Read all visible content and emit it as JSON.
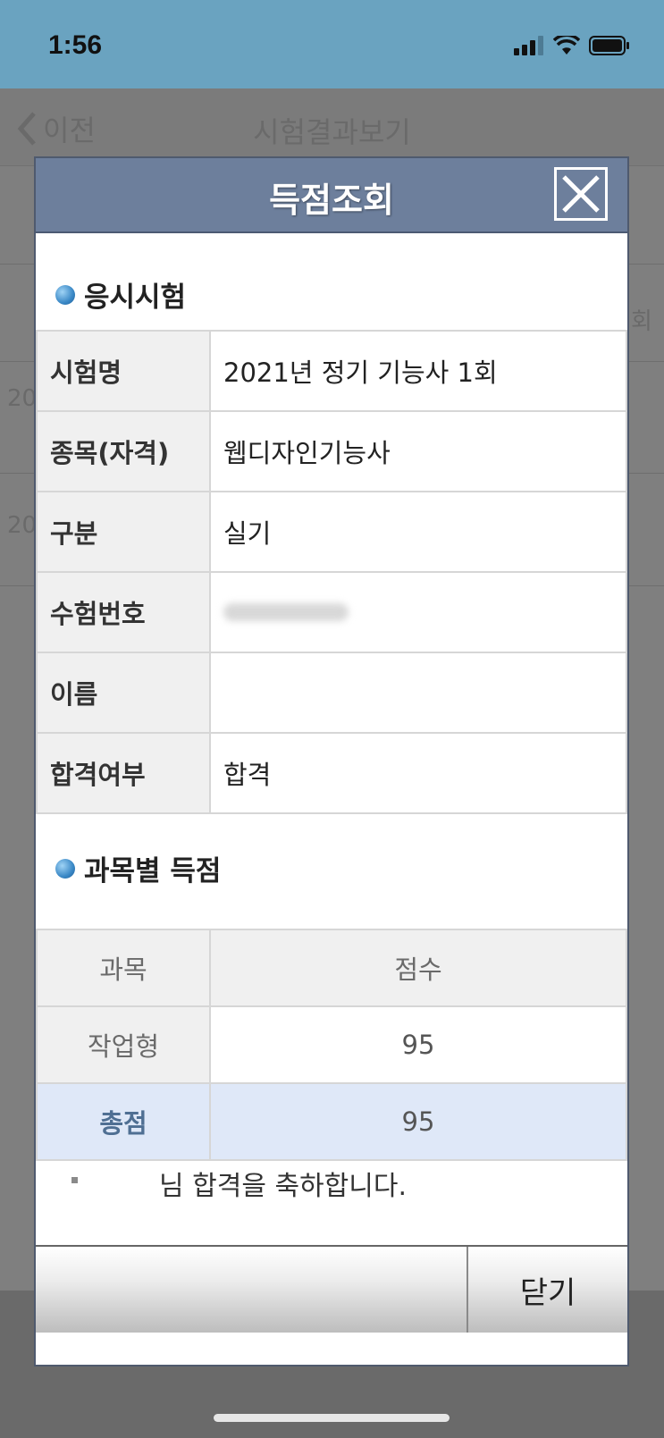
{
  "status": {
    "time": "1:56"
  },
  "background_app": {
    "back_label": "이전",
    "title": "시험결과보기",
    "partial_texts": [
      "20",
      "20"
    ],
    "partial_right": "회"
  },
  "modal": {
    "title": "득점조회",
    "exam_section": {
      "heading": "응시시험",
      "rows": [
        {
          "label": "시험명",
          "value": "2021년 정기 기능사 1회"
        },
        {
          "label": "종목(자격)",
          "value": "웹디자인기능사"
        },
        {
          "label": "구분",
          "value": "실기"
        },
        {
          "label": "수험번호",
          "value": ""
        },
        {
          "label": "이름",
          "value": ""
        },
        {
          "label": "합격여부",
          "value": "합격"
        }
      ]
    },
    "score_section": {
      "heading": "과목별 득점",
      "columns": [
        "과목",
        "점수"
      ],
      "rows": [
        {
          "subject": "작업형",
          "score": "95"
        }
      ],
      "total": {
        "label": "총점",
        "score": "95"
      }
    },
    "congrats_message": "님 합격을 축하합니다.",
    "close_button_label": "닫기"
  }
}
